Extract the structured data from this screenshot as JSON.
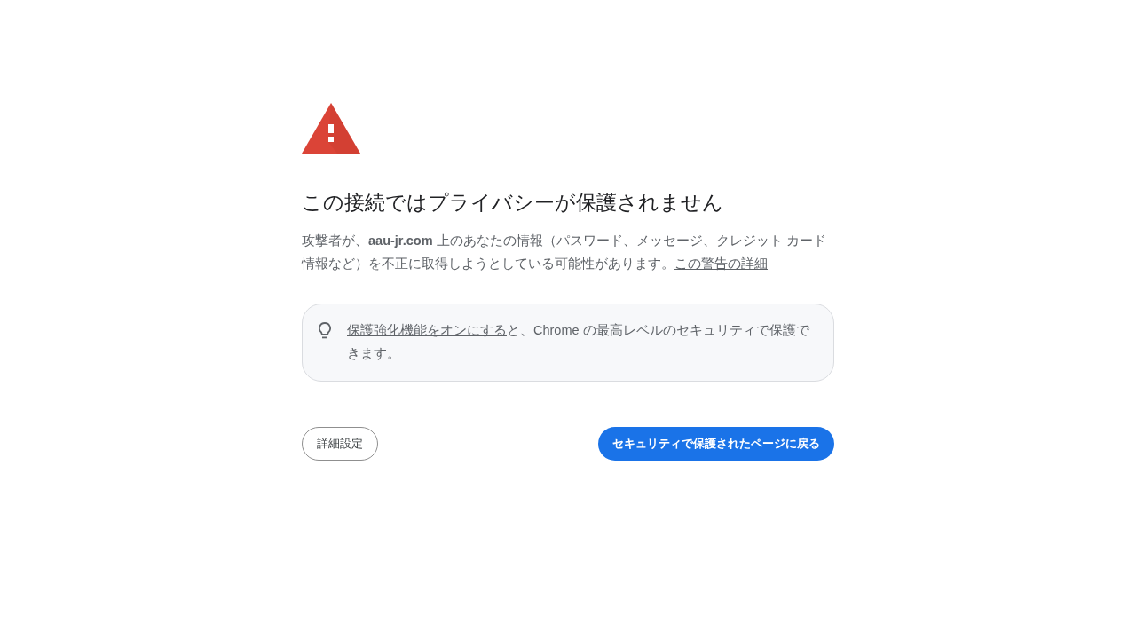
{
  "heading": "この接続ではプライバシーが保護されません",
  "description": {
    "text": "攻撃者が、**aau-jr.com** 上のあなたの情報（パスワード、メッセージ、クレジット カード情報など）を不正に取得しようとしている可能性があります。",
    "link": "この警告の詳細"
  },
  "tip": {
    "link": "保護強化機能をオンにする",
    "text": "と、Chrome の最高レベルのセキュリティで保護できます。"
  },
  "buttons": [
    {
      "label": "詳細設定",
      "kind": "secondary"
    },
    {
      "label": "セキュリティで保護されたページに戻る",
      "kind": "primary"
    }
  ]
}
